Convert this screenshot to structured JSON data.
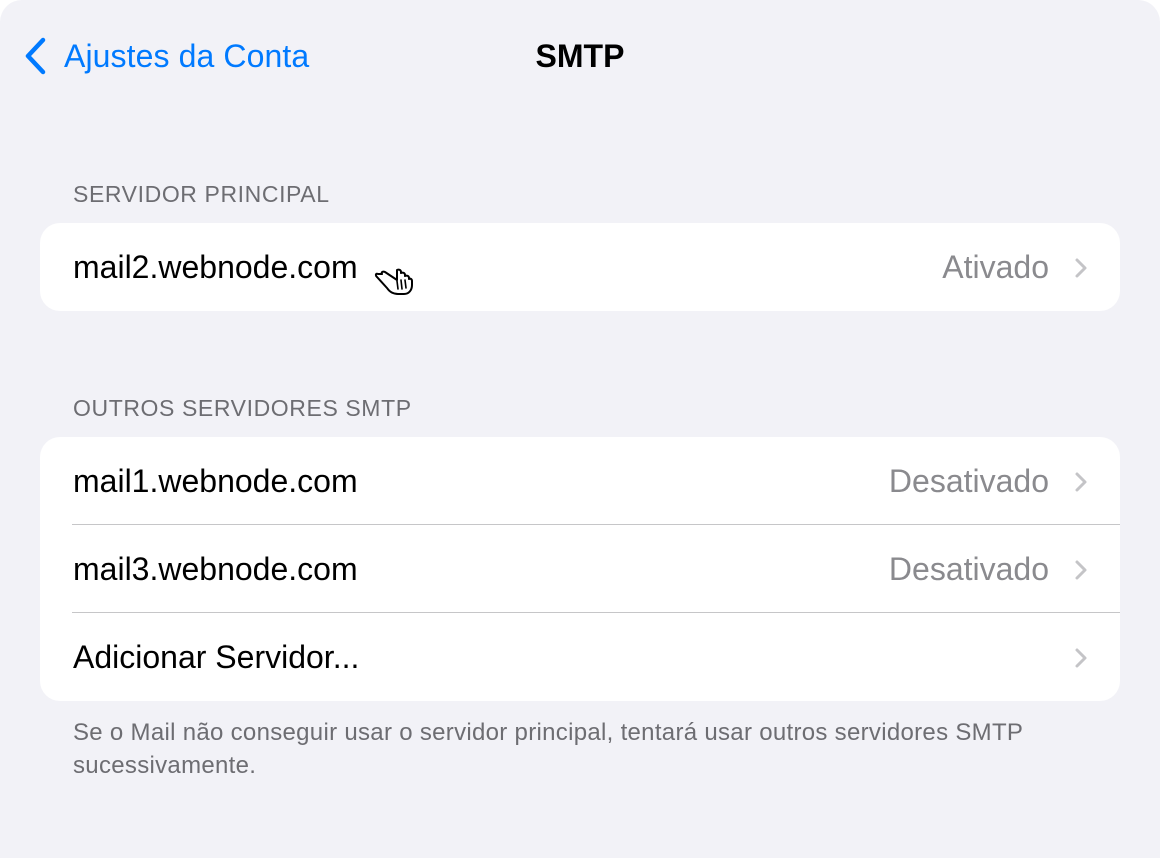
{
  "navbar": {
    "back_label": "Ajustes da Conta",
    "title": "SMTP"
  },
  "primary_section": {
    "header": "SERVIDOR PRINCIPAL",
    "server": {
      "name": "mail2.webnode.com",
      "status": "Ativado"
    }
  },
  "other_section": {
    "header": "OUTROS SERVIDORES SMTP",
    "servers": [
      {
        "name": "mail1.webnode.com",
        "status": "Desativado"
      },
      {
        "name": "mail3.webnode.com",
        "status": "Desativado"
      }
    ],
    "add_label": "Adicionar Servidor..."
  },
  "footer_note": "Se o Mail não conseguir usar o servidor principal, tentará usar outros servidores SMTP sucessivamente.",
  "colors": {
    "accent": "#007aff",
    "background": "#f2f2f7",
    "secondary_text": "#8a8a8e"
  },
  "icons": {
    "back": "chevron-left-icon",
    "disclosure": "chevron-right-icon",
    "cursor": "hand-pointer-icon"
  }
}
